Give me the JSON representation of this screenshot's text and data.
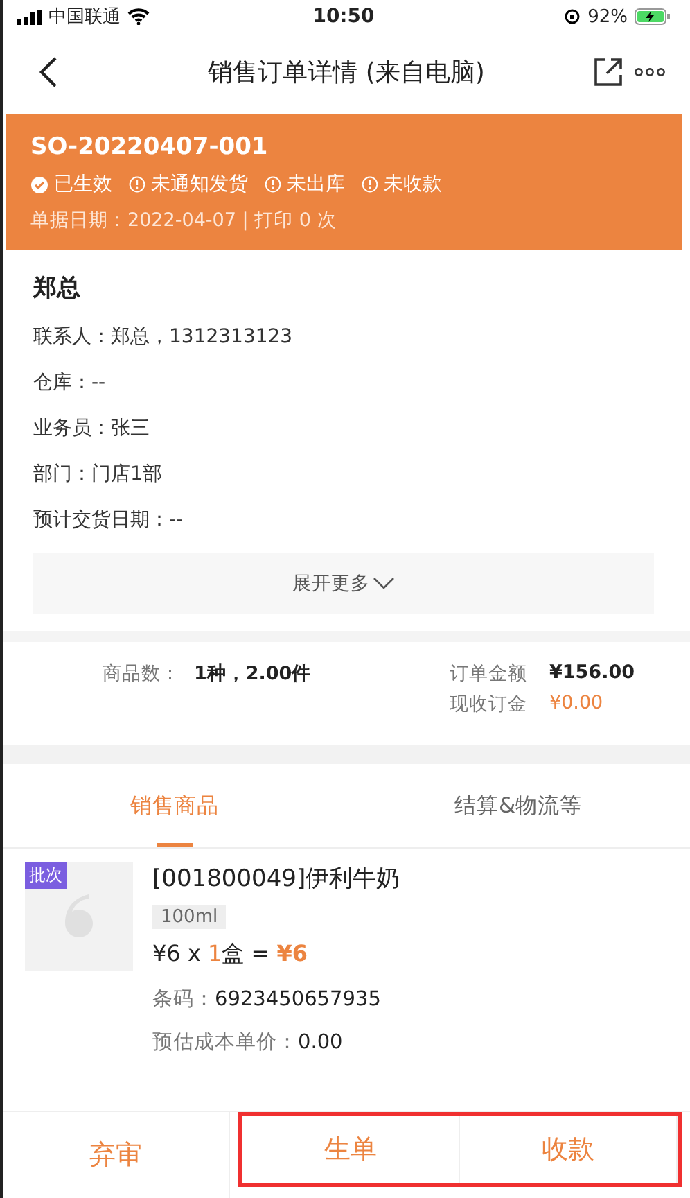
{
  "status_bar": {
    "carrier": "中国联通",
    "time": "10:50",
    "battery": "92%"
  },
  "nav": {
    "title": "销售订单详情 (来自电脑)"
  },
  "order": {
    "number": "SO-20220407-001",
    "statuses": [
      {
        "kind": "done",
        "label": "已生效"
      },
      {
        "kind": "pending",
        "label": "未通知发货"
      },
      {
        "kind": "pending",
        "label": "未出库"
      },
      {
        "kind": "pending",
        "label": "未收款"
      }
    ],
    "meta": "单据日期：2022-04-07 | 打印 0 次"
  },
  "customer": {
    "name": "郑总",
    "fields": [
      {
        "text": "联系人：郑总，1312313123"
      },
      {
        "text": "仓库：--"
      },
      {
        "text": "业务员：张三"
      },
      {
        "text": "部门：门店1部"
      },
      {
        "text": "预计交货日期：--"
      }
    ],
    "expand": "展开更多"
  },
  "summary": {
    "count_label": "商品数：",
    "count_value": "1种，2.00件",
    "amount_label": "订单金额",
    "amount_value": "¥156.00",
    "deposit_label": "现收订金",
    "deposit_value": "¥0.00"
  },
  "tabs": [
    {
      "label": "销售商品",
      "selected": true
    },
    {
      "label": "结算&物流等",
      "selected": false
    }
  ],
  "product": {
    "badge": "批次",
    "name": "[001800049]伊利牛奶",
    "spec": "100ml",
    "price": "¥6 x ",
    "qty": "1",
    "unit": "盒 = ",
    "total": "¥6",
    "barcode_label": "条码：",
    "barcode": "6923450657935",
    "cost_label": "预估成本单价：",
    "cost": "0.00"
  },
  "actions": [
    {
      "label": "弃审",
      "highlighted": false
    },
    {
      "label": "生单",
      "highlighted": true
    },
    {
      "label": "收款",
      "highlighted": true
    }
  ]
}
